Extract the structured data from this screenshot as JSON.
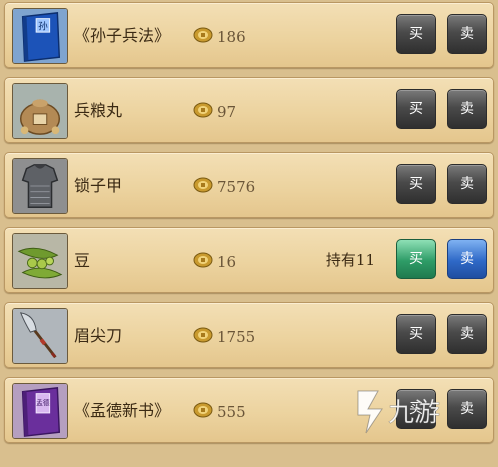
{
  "buttons": {
    "buy_label": "买",
    "sell_label": "卖"
  },
  "items": [
    {
      "name": "《孙子兵法》",
      "price": "186",
      "held": "",
      "icon": "blue-book-icon"
    },
    {
      "name": "兵粮丸",
      "price": "97",
      "held": "",
      "icon": "grain-sack-icon"
    },
    {
      "name": "锁子甲",
      "price": "7576",
      "held": "",
      "icon": "chainmail-armor-icon"
    },
    {
      "name": "豆",
      "price": "16",
      "held": "持有11",
      "icon": "bean-pod-icon"
    },
    {
      "name": "眉尖刀",
      "price": "1755",
      "held": "",
      "icon": "glaive-icon"
    },
    {
      "name": "《孟德新书》",
      "price": "555",
      "held": "",
      "icon": "purple-book-icon"
    }
  ],
  "book_glyphs": {
    "blue": "孙",
    "purple": "孟德"
  },
  "watermark": {
    "text": "九游"
  },
  "colors": {
    "panel": "#ecd39f",
    "button_dark": "#4a4a4a",
    "button_green": "#2e9c67",
    "button_blue": "#2f69c7"
  }
}
